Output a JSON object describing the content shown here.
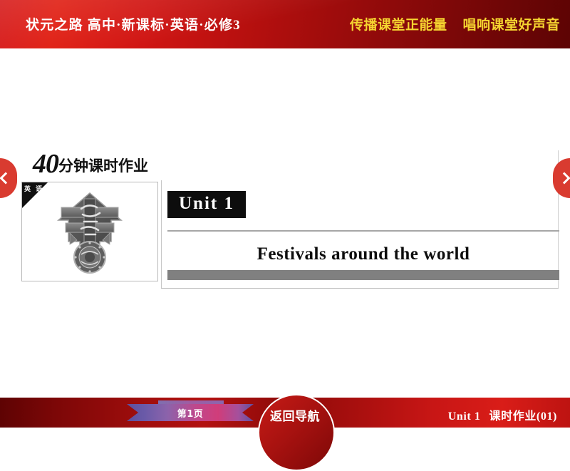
{
  "header": {
    "book_title": "状元之路  高中·新课标·英语·必修3",
    "slogan_left": "传播课堂正能量",
    "slogan_right": "唱响课堂好声音",
    "bg_start_color": "#d51616",
    "bg_end_color": "#5d0404",
    "slogan_color": "#f5d430",
    "title_color": "#ffffff"
  },
  "main": {
    "worksheet": {
      "number": "40",
      "label": "分钟课时作业"
    },
    "thumbnail": {
      "corner_label": "英 语",
      "art_name": "wanshiruyi-seal-ornament"
    },
    "unit": {
      "badge": "Unit 1",
      "title_part1": "Festivals",
      "title_part2": "around",
      "title_part3": "the",
      "title_part4": "world",
      "badge_bg_color": "#0d0d0d",
      "badge_text_color": "#ffffff",
      "rule_color": "#a6a6a6",
      "bar_color": "#808080"
    },
    "nav": {
      "prev_icon": "chevron-left-icon",
      "next_icon": "chevron-right-icon",
      "arrow_color": "#d93b30"
    }
  },
  "footer": {
    "page_label": "第1页",
    "return_nav_label": "返回导航",
    "right_label_unit": "Unit 1",
    "right_label_task": "课时作业(01)",
    "bg_start_color": "#5e0303",
    "bg_end_color": "#d91d18",
    "ribbon_start_color": "#5c4f9e",
    "ribbon_end_color": "#d03d7a"
  }
}
